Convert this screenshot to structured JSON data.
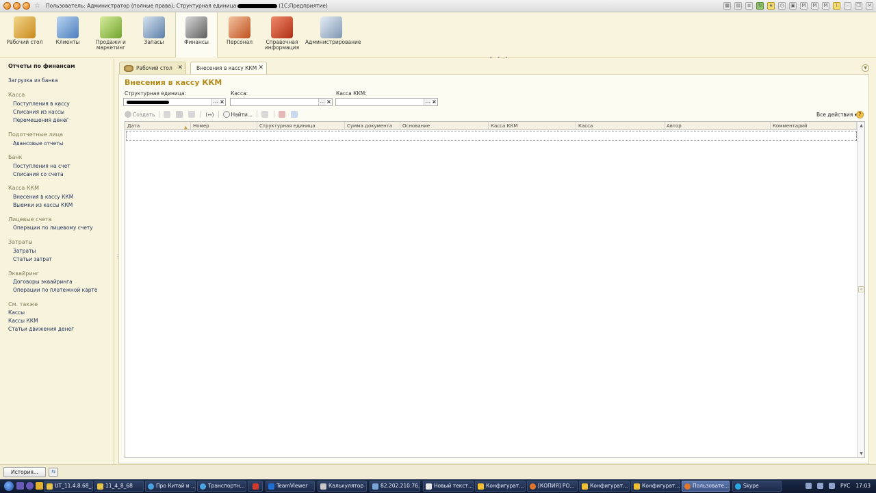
{
  "window": {
    "title_prefix": "Пользователь: Администратор (полные права); Структурная единица",
    "title_suffix": "(1С:Предприятие)"
  },
  "sections": [
    {
      "label": "Рабочий стол",
      "icon": "desktop-icon",
      "color": "#d6a23a"
    },
    {
      "label": "Клиенты",
      "icon": "clients-icon",
      "color": "#5f8ec9"
    },
    {
      "label": "Продажи и маркетинг",
      "icon": "sales-chart-icon",
      "color": "#7fb53d"
    },
    {
      "label": "Запасы",
      "icon": "stock-icon",
      "color": "#6a8fb8"
    },
    {
      "label": "Финансы",
      "icon": "cash-register-icon",
      "color": "#6d6d6d"
    },
    {
      "label": "Персонал",
      "icon": "personnel-icon",
      "color": "#d05a2a"
    },
    {
      "label": "Справочная информация",
      "icon": "reference-book-icon",
      "color": "#c43a1e"
    },
    {
      "label": "Администрирование",
      "icon": "admin-icon",
      "color": "#8aa0b8"
    }
  ],
  "leftnav": {
    "top_link": "Отчеты по финансам",
    "bank_load": "Загрузка из банка",
    "groups": [
      {
        "title": "Касса",
        "items": [
          "Поступления в кассу",
          "Списания из кассы",
          "Перемещения денег"
        ]
      },
      {
        "title": "Подотчетные лица",
        "items": [
          "Авансовые отчеты"
        ]
      },
      {
        "title": "Банк",
        "items": [
          "Поступления на счет",
          "Списания со счета"
        ]
      },
      {
        "title": "Касса ККМ",
        "items": [
          "Внесения в кассу ККМ",
          "Выемки из кассы ККМ"
        ]
      },
      {
        "title": "Лицевые счета",
        "items": [
          "Операции по лицевому счету"
        ]
      },
      {
        "title": "Затраты",
        "items": [
          "Затраты",
          "Статьи затрат"
        ]
      },
      {
        "title": "Эквайринг",
        "items": [
          "Договоры эквайринга",
          "Операции по платежной карте"
        ]
      }
    ],
    "see_also": {
      "title": "См. также",
      "items": [
        "Кассы",
        "Кассы ККМ",
        "Статьи движения денег"
      ]
    }
  },
  "tabs": [
    {
      "label": "Рабочий стол"
    },
    {
      "label": "Внесения в кассу ККМ"
    }
  ],
  "form": {
    "title": "Внесения в кассу ККМ",
    "filters": [
      {
        "label": "Структурная единица:",
        "value": ""
      },
      {
        "label": "Касса:",
        "value": ""
      },
      {
        "label": "Касса ККМ:",
        "value": ""
      }
    ],
    "select_btn": "...",
    "clear_btn": "×",
    "commands": {
      "create": "Создать",
      "find": "Найти...",
      "all_actions": "Все действия ▾",
      "help": "?"
    },
    "columns": [
      "Дата",
      "Номер",
      "Структурная единица",
      "Сумма документа",
      "Основание",
      "Касса ККМ",
      "Касса",
      "Автор",
      "Комментарий"
    ]
  },
  "history": {
    "button": "История..."
  },
  "taskbar": {
    "items": [
      {
        "label": "UT_11.4.8.68_...",
        "color": "#e6c24a"
      },
      {
        "label": "11_4_8_68",
        "color": "#e6c24a"
      },
      {
        "label": "Про Китай и ...",
        "color": "#4aa3e0"
      },
      {
        "label": "Транспортн...",
        "color": "#4aa3e0"
      },
      {
        "label": "",
        "color": "#d23a2a"
      },
      {
        "label": "TeamViewer",
        "color": "#1f6fd1"
      },
      {
        "label": "Калькулятор",
        "color": "#c8c8c8"
      },
      {
        "label": "82.202.210.76...",
        "color": "#7aa3d6"
      },
      {
        "label": "Новый текст...",
        "color": "#e8e8e8"
      },
      {
        "label": "Конфигурат...",
        "color": "#f0c030"
      },
      {
        "label": "[КОПИЯ] РО...",
        "color": "#e0762a"
      },
      {
        "label": "Конфигурат...",
        "color": "#f0c030"
      },
      {
        "label": "Конфигурат...",
        "color": "#f0c030"
      },
      {
        "label": "Пользовате...",
        "color": "#e0762a"
      },
      {
        "label": "Skype",
        "color": "#2aa6e0"
      }
    ],
    "lang": "РУС",
    "time": "17:03"
  }
}
